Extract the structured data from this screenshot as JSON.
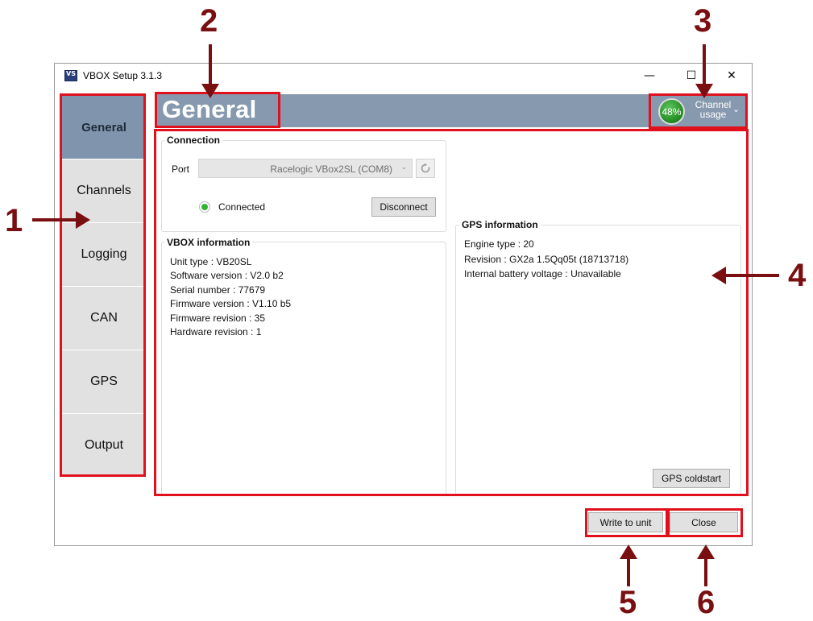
{
  "window": {
    "title": "VBOX Setup 3.1.3",
    "controls": {
      "minimize": "—",
      "maximize": "☐",
      "close": "✕"
    }
  },
  "nav": {
    "items": [
      {
        "label": "General",
        "active": true
      },
      {
        "label": "Channels",
        "active": false
      },
      {
        "label": "Logging",
        "active": false
      },
      {
        "label": "CAN",
        "active": false
      },
      {
        "label": "GPS",
        "active": false
      },
      {
        "label": "Output",
        "active": false
      }
    ]
  },
  "header": {
    "title": "General",
    "channel_usage": {
      "percent": "48%",
      "label_line1": "Channel",
      "label_line2": "usage"
    }
  },
  "connection": {
    "title": "Connection",
    "port_label": "Port",
    "port_value": "Racelogic VBox2SL (COM8)",
    "status": "Connected",
    "disconnect_label": "Disconnect"
  },
  "vbox_info": {
    "title": "VBOX information",
    "lines": [
      "Unit type : VB20SL",
      "Software version : V2.0 b2",
      "Serial number : 77679",
      "Firmware version : V1.10 b5",
      "Firmware revision : 35",
      "Hardware revision : 1"
    ]
  },
  "gps_info": {
    "title": "GPS information",
    "lines": [
      "Engine type : 20",
      "Revision : GX2a 1.5Qq05t (18713718)",
      "Internal battery voltage : Unavailable"
    ],
    "coldstart_label": "GPS coldstart"
  },
  "footer": {
    "write_label": "Write to unit",
    "close_label": "Close"
  },
  "annotations": {
    "labels": [
      "1",
      "2",
      "3",
      "4",
      "5",
      "6"
    ],
    "box_color": "#e0101d",
    "arrow_color": "#7a0f12"
  },
  "colors": {
    "header_bg": "#8699ae",
    "nav_active_bg": "#8095ad",
    "status_green": "#2fb52f"
  }
}
